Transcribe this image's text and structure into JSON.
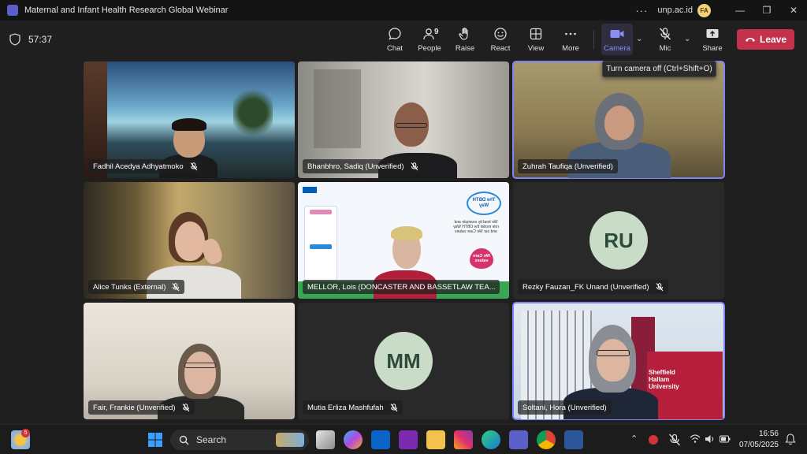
{
  "window": {
    "title": "Maternal and Infant Health Research Global Webinar",
    "org": "unp.ac.id",
    "avatar_initials": "FA"
  },
  "toolbar": {
    "timer": "57:37",
    "chat": "Chat",
    "people": "People",
    "people_count": "9",
    "raise": "Raise",
    "react": "React",
    "view": "View",
    "more": "More",
    "camera": "Camera",
    "mic": "Mic",
    "share": "Share",
    "leave": "Leave",
    "camera_tooltip": "Turn camera off (Ctrl+Shift+O)",
    "accent": "#7f85f5",
    "leave_color": "#c4314b"
  },
  "participants": [
    {
      "name": "Fadhil Acedya Adhyatmoko",
      "muted": true,
      "speaking": false
    },
    {
      "name": "Bhanbhro, Sadiq (Unverified)",
      "muted": true,
      "speaking": false
    },
    {
      "name": "Zuhrah Taufiqa (Unverified)",
      "muted": false,
      "speaking": true
    },
    {
      "name": "Alice Tunks (External)",
      "muted": true,
      "speaking": false
    },
    {
      "name": "MELLOR, Lois (DONCASTER AND BASSETLAW TEA...",
      "muted": true,
      "speaking": false,
      "slide_text": {
        "brand": "The DBTH Way",
        "tagline": "We lead by example and role model the DBTH Way and our We Care values",
        "badge": "We Care values"
      }
    },
    {
      "name": "Rezky Fauzan_FK Unand (Unverified)",
      "muted": true,
      "speaking": false,
      "initials": "RU"
    },
    {
      "name": "Fair, Frankie (Unverified)",
      "muted": true,
      "speaking": false
    },
    {
      "name": "Mutia Erliza Mashfufah",
      "muted": true,
      "speaking": false,
      "initials": "MM"
    },
    {
      "name": "Soltani, Hora (Unverified)",
      "muted": false,
      "speaking": true,
      "building_sign": "Sheffield Hallam University"
    }
  ],
  "taskbar": {
    "search_placeholder": "Search",
    "weather_badge": "5",
    "time": "16:56",
    "date": "07/05/2025"
  }
}
